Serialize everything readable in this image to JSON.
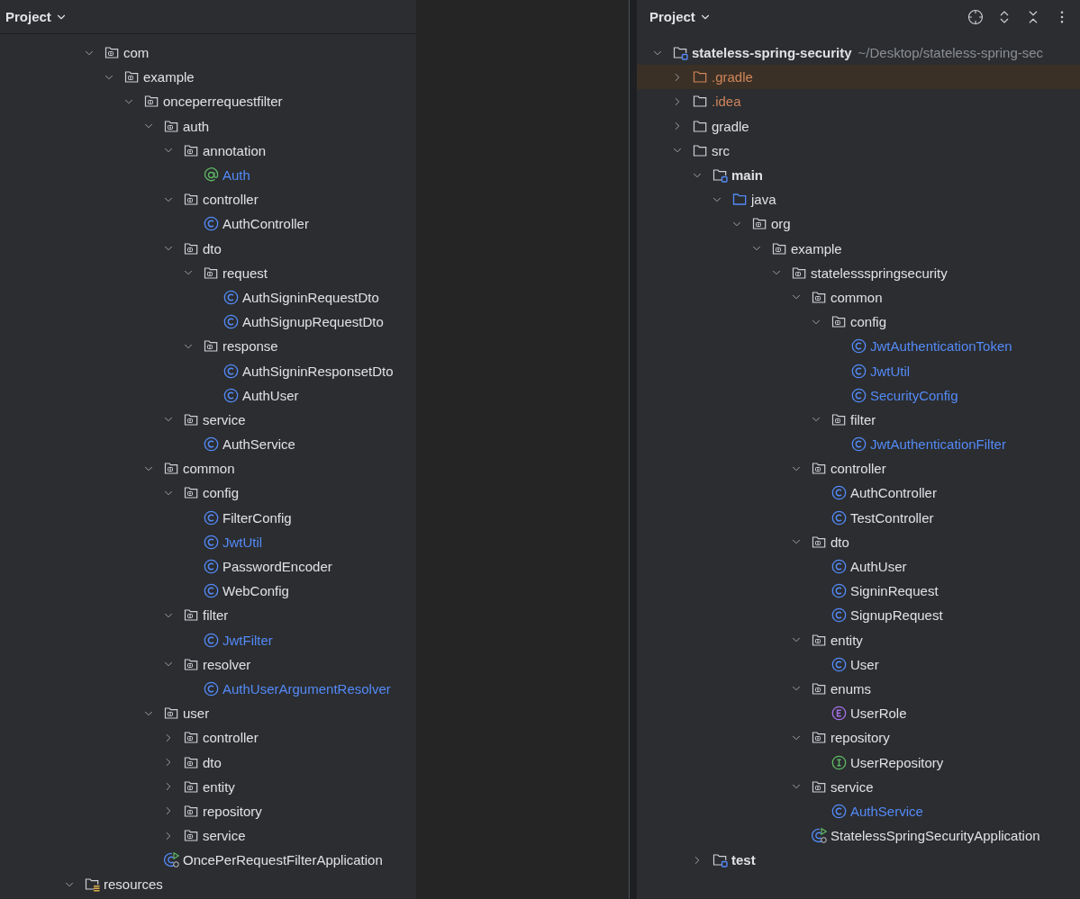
{
  "left_panel": {
    "title": "Project",
    "tree": [
      {
        "children": [
          {
            "children": [
              {
                "name": "com",
                "kind": "package",
                "expanded": true,
                "selected": false,
                "children": [
                  {
                    "name": "example",
                    "kind": "package",
                    "expanded": true,
                    "selected": false,
                    "children": [
                      {
                        "name": "onceperrequestfilter",
                        "kind": "package",
                        "expanded": true,
                        "selected": false,
                        "children": [
                          {
                            "name": "auth",
                            "kind": "package",
                            "expanded": true,
                            "selected": false,
                            "children": [
                              {
                                "name": "annotation",
                                "kind": "package",
                                "expanded": true,
                                "selected": false,
                                "children": [
                                  {
                                    "name": "Auth",
                                    "kind": "annotation",
                                    "selected": false,
                                    "color": "#548af7"
                                  }
                                ]
                              },
                              {
                                "name": "controller",
                                "kind": "package",
                                "expanded": true,
                                "selected": false,
                                "children": [
                                  {
                                    "name": "AuthController",
                                    "kind": "class",
                                    "selected": false
                                  }
                                ]
                              },
                              {
                                "name": "dto",
                                "kind": "package",
                                "expanded": true,
                                "selected": false,
                                "children": [
                                  {
                                    "name": "request",
                                    "kind": "package",
                                    "expanded": true,
                                    "selected": false,
                                    "children": [
                                      {
                                        "name": "AuthSigninRequestDto",
                                        "kind": "class",
                                        "selected": false
                                      },
                                      {
                                        "name": "AuthSignupRequestDto",
                                        "kind": "class",
                                        "selected": false
                                      }
                                    ]
                                  },
                                  {
                                    "name": "response",
                                    "kind": "package",
                                    "expanded": true,
                                    "selected": false,
                                    "children": [
                                      {
                                        "name": "AuthSigninResponsetDto",
                                        "kind": "class",
                                        "selected": false
                                      },
                                      {
                                        "name": "AuthUser",
                                        "kind": "class",
                                        "selected": false
                                      }
                                    ]
                                  }
                                ]
                              },
                              {
                                "name": "service",
                                "kind": "package",
                                "expanded": true,
                                "selected": false,
                                "children": [
                                  {
                                    "name": "AuthService",
                                    "kind": "class",
                                    "selected": false
                                  }
                                ]
                              }
                            ]
                          },
                          {
                            "name": "common",
                            "kind": "package",
                            "expanded": true,
                            "selected": false,
                            "children": [
                              {
                                "name": "config",
                                "kind": "package",
                                "expanded": true,
                                "selected": false,
                                "children": [
                                  {
                                    "name": "FilterConfig",
                                    "kind": "class",
                                    "selected": false
                                  },
                                  {
                                    "name": "JwtUtil",
                                    "kind": "class",
                                    "selected": false,
                                    "color": "#548af7"
                                  },
                                  {
                                    "name": "PasswordEncoder",
                                    "kind": "class",
                                    "selected": false
                                  },
                                  {
                                    "name": "WebConfig",
                                    "kind": "class",
                                    "selected": false
                                  }
                                ]
                              },
                              {
                                "name": "filter",
                                "kind": "package",
                                "expanded": true,
                                "selected": false,
                                "children": [
                                  {
                                    "name": "JwtFilter",
                                    "kind": "class",
                                    "selected": false,
                                    "color": "#548af7"
                                  }
                                ]
                              },
                              {
                                "name": "resolver",
                                "kind": "package",
                                "expanded": true,
                                "selected": false,
                                "children": [
                                  {
                                    "name": "AuthUserArgumentResolver",
                                    "kind": "class",
                                    "selected": false,
                                    "color": "#548af7"
                                  }
                                ]
                              }
                            ]
                          },
                          {
                            "name": "user",
                            "kind": "package",
                            "expanded": true,
                            "selected": false,
                            "children": [
                              {
                                "name": "controller",
                                "kind": "package",
                                "expanded": false,
                                "selected": false
                              },
                              {
                                "name": "dto",
                                "kind": "package",
                                "expanded": false,
                                "selected": false
                              },
                              {
                                "name": "entity",
                                "kind": "package",
                                "expanded": false,
                                "selected": false
                              },
                              {
                                "name": "repository",
                                "kind": "package",
                                "expanded": false,
                                "selected": false
                              },
                              {
                                "name": "service",
                                "kind": "package",
                                "expanded": false,
                                "selected": false
                              }
                            ]
                          },
                          {
                            "name": "OncePerRequestFilterApplication",
                            "kind": "application",
                            "selected": false
                          }
                        ]
                      }
                    ]
                  }
                ]
              }
            ]
          },
          {
            "name": "resources",
            "kind": "resources-root",
            "expanded": true,
            "selected": false
          }
        ]
      }
    ]
  },
  "right_panel": {
    "title": "Project",
    "tree": [
      {
        "name": "stateless-spring-security",
        "path": "~/Desktop/stateless-spring-sec",
        "kind": "module",
        "expanded": true,
        "selected": false,
        "children": [
          {
            "name": ".gradle",
            "kind": "excluded-folder",
            "expanded": false,
            "selected": true,
            "color": "#d0855a"
          },
          {
            "name": ".idea",
            "kind": "folder",
            "expanded": false,
            "selected": false,
            "color": "#d0855a"
          },
          {
            "name": "gradle",
            "kind": "folder",
            "expanded": false,
            "selected": false
          },
          {
            "name": "src",
            "kind": "folder",
            "expanded": true,
            "selected": false,
            "children": [
              {
                "name": "main",
                "kind": "module",
                "expanded": true,
                "selected": false,
                "children": [
                  {
                    "name": "java",
                    "kind": "source-root",
                    "expanded": true,
                    "selected": false,
                    "children": [
                      {
                        "name": "org",
                        "kind": "package",
                        "expanded": true,
                        "selected": false,
                        "children": [
                          {
                            "name": "example",
                            "kind": "package",
                            "expanded": true,
                            "selected": false,
                            "children": [
                              {
                                "name": "statelessspringsecurity",
                                "kind": "package",
                                "expanded": true,
                                "selected": false,
                                "children": [
                                  {
                                    "name": "common",
                                    "kind": "package",
                                    "expanded": true,
                                    "selected": false,
                                    "children": [
                                      {
                                        "name": "config",
                                        "kind": "package",
                                        "expanded": true,
                                        "selected": false,
                                        "children": [
                                          {
                                            "name": "JwtAuthenticationToken",
                                            "kind": "class",
                                            "selected": false,
                                            "color": "#548af7"
                                          },
                                          {
                                            "name": "JwtUtil",
                                            "kind": "class",
                                            "selected": false,
                                            "color": "#548af7"
                                          },
                                          {
                                            "name": "SecurityConfig",
                                            "kind": "class",
                                            "selected": false,
                                            "color": "#548af7"
                                          }
                                        ]
                                      },
                                      {
                                        "name": "filter",
                                        "kind": "package",
                                        "expanded": true,
                                        "selected": false,
                                        "children": [
                                          {
                                            "name": "JwtAuthenticationFilter",
                                            "kind": "class",
                                            "selected": false,
                                            "color": "#548af7"
                                          }
                                        ]
                                      }
                                    ]
                                  },
                                  {
                                    "name": "controller",
                                    "kind": "package",
                                    "expanded": true,
                                    "selected": false,
                                    "children": [
                                      {
                                        "name": "AuthController",
                                        "kind": "class",
                                        "selected": false
                                      },
                                      {
                                        "name": "TestController",
                                        "kind": "class",
                                        "selected": false
                                      }
                                    ]
                                  },
                                  {
                                    "name": "dto",
                                    "kind": "package",
                                    "expanded": true,
                                    "selected": false,
                                    "children": [
                                      {
                                        "name": "AuthUser",
                                        "kind": "class",
                                        "selected": false
                                      },
                                      {
                                        "name": "SigninRequest",
                                        "kind": "class",
                                        "selected": false
                                      },
                                      {
                                        "name": "SignupRequest",
                                        "kind": "class",
                                        "selected": false
                                      }
                                    ]
                                  },
                                  {
                                    "name": "entity",
                                    "kind": "package",
                                    "expanded": true,
                                    "selected": false,
                                    "children": [
                                      {
                                        "name": "User",
                                        "kind": "class",
                                        "selected": false
                                      }
                                    ]
                                  },
                                  {
                                    "name": "enums",
                                    "kind": "package",
                                    "expanded": true,
                                    "selected": false,
                                    "children": [
                                      {
                                        "name": "UserRole",
                                        "kind": "enum",
                                        "selected": false
                                      }
                                    ]
                                  },
                                  {
                                    "name": "repository",
                                    "kind": "package",
                                    "expanded": true,
                                    "selected": false,
                                    "children": [
                                      {
                                        "name": "UserRepository",
                                        "kind": "interface",
                                        "selected": false
                                      }
                                    ]
                                  },
                                  {
                                    "name": "service",
                                    "kind": "package",
                                    "expanded": true,
                                    "selected": false,
                                    "children": [
                                      {
                                        "name": "AuthService",
                                        "kind": "class",
                                        "selected": false,
                                        "color": "#548af7"
                                      }
                                    ]
                                  },
                                  {
                                    "name": "StatelessSpringSecurityApplication",
                                    "kind": "application",
                                    "selected": false
                                  }
                                ]
                              }
                            ]
                          }
                        ]
                      }
                    ]
                  }
                ]
              },
              {
                "name": "test",
                "kind": "module",
                "expanded": false,
                "selected": false
              }
            ]
          }
        ]
      }
    ]
  }
}
